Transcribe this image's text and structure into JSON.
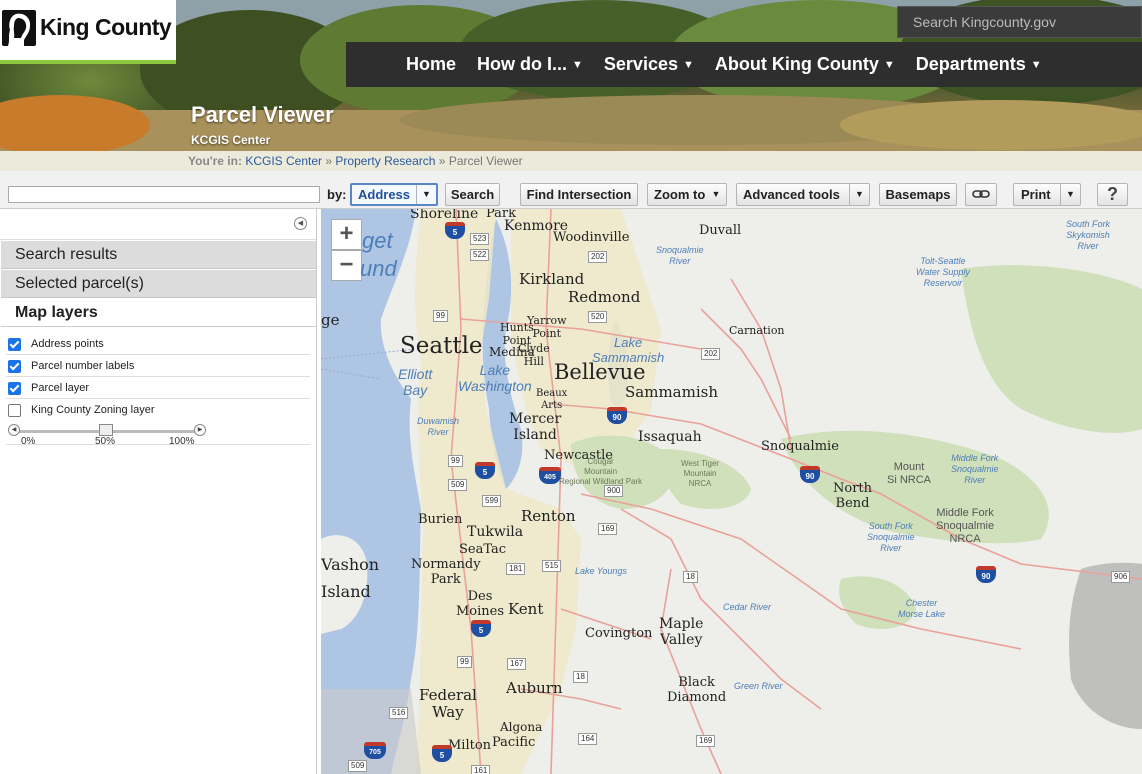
{
  "header": {
    "logo_text": "King County",
    "site_search_placeholder": "Search Kingcounty.gov",
    "nav": [
      {
        "label": "Home",
        "has_menu": false
      },
      {
        "label": "How do I...",
        "has_menu": true
      },
      {
        "label": "Services",
        "has_menu": true
      },
      {
        "label": "About King County",
        "has_menu": true
      },
      {
        "label": "Departments",
        "has_menu": true
      }
    ],
    "caret": "▼",
    "title": "Parcel Viewer",
    "subtitle": "KCGIS Center"
  },
  "breadcrumb": {
    "prefix": "You're in:",
    "items": [
      "KCGIS Center",
      "Property Research"
    ],
    "separator": "»",
    "current": "Parcel Viewer"
  },
  "toolbar": {
    "search_value": "",
    "by_label": "by:",
    "address_label": "Address",
    "search_label": "Search",
    "find_intersection_label": "Find Intersection",
    "zoom_to_label": "Zoom to",
    "advanced_tools_label": "Advanced tools",
    "basemaps_label": "Basemaps",
    "print_label": "Print",
    "help_label": "?"
  },
  "left_panel": {
    "sections": [
      "Search results",
      "Selected parcel(s)",
      "Map layers"
    ],
    "layers": [
      {
        "label": "Address points",
        "checked": true
      },
      {
        "label": "Parcel number labels",
        "checked": true
      },
      {
        "label": "Parcel layer",
        "checked": true
      }
    ],
    "zoning": {
      "label": "King County Zoning layer",
      "checked": false,
      "opacity": 0.5
    },
    "opacity_ticks": [
      "0%",
      "50%",
      "100%"
    ]
  },
  "map": {
    "zoom_in": "+",
    "zoom_out": "−",
    "places": [
      {
        "name": "Shoreline",
        "big": false
      },
      {
        "name": "Park",
        "big": false
      },
      {
        "name": "Kenmore",
        "big": false
      },
      {
        "name": "Woodinville",
        "big": false
      },
      {
        "name": "Duvall",
        "big": false
      },
      {
        "name": "Kirkland",
        "big": false
      },
      {
        "name": "Redmond",
        "big": false
      },
      {
        "name": "Hunts Point",
        "big": false
      },
      {
        "name": "Yarrow Point",
        "big": false
      },
      {
        "name": "Medina",
        "big": false
      },
      {
        "name": "Clyde Hill",
        "big": false
      },
      {
        "name": "Carnation",
        "big": false
      },
      {
        "name": "Seattle",
        "big": true
      },
      {
        "name": "Bellevue",
        "big": true
      },
      {
        "name": "Sammamish",
        "big": false
      },
      {
        "name": "Beaux Arts",
        "big": false
      },
      {
        "name": "Mercer Island",
        "big": false
      },
      {
        "name": "Issaquah",
        "big": false
      },
      {
        "name": "Snoqualmie",
        "big": false
      },
      {
        "name": "Newcastle",
        "big": false
      },
      {
        "name": "North Bend",
        "big": false
      },
      {
        "name": "Burien",
        "big": false
      },
      {
        "name": "Tukwila",
        "big": false
      },
      {
        "name": "SeaTac",
        "big": false
      },
      {
        "name": "Renton",
        "big": false
      },
      {
        "name": "Vashon Island",
        "big": false
      },
      {
        "name": "Normandy Park",
        "big": false
      },
      {
        "name": "Des Moines",
        "big": false
      },
      {
        "name": "Kent",
        "big": false
      },
      {
        "name": "Covington",
        "big": false
      },
      {
        "name": "Maple Valley",
        "big": false
      },
      {
        "name": "Black Diamond",
        "big": false
      },
      {
        "name": "Federal Way",
        "big": false
      },
      {
        "name": "Auburn",
        "big": false
      },
      {
        "name": "Algona",
        "big": false
      },
      {
        "name": "Milton",
        "big": false
      },
      {
        "name": "Pacific",
        "big": false
      },
      {
        "name": "ge",
        "big": false
      }
    ],
    "water_labels": [
      "get",
      "und",
      "Snoqualmie River",
      "South Fork Skykomish River",
      "Tolt-Seattle Water Supply Reservoir",
      "Lake Sammamish",
      "Elliott Bay",
      "Lake Washington",
      "Duwamish River",
      "Lake Youngs",
      "Cedar River",
      "Chester Morse Lake",
      "Green River",
      "Middle Fork Snoqualmie River",
      "South Fork Snoqualmie River"
    ],
    "park_labels": [
      "Cougar Mountain Regional Wildland Park",
      "West Tiger Mountain NRCA",
      "Mount Si NRCA",
      "Middle Fork Snoqualmie NRCA"
    ],
    "interstates": [
      "5",
      "5",
      "5",
      "5",
      "90",
      "90",
      "90",
      "405",
      "705"
    ],
    "routes": [
      "523",
      "522",
      "202",
      "99",
      "520",
      "202",
      "99",
      "509",
      "599",
      "169",
      "181",
      "515",
      "18",
      "516",
      "167",
      "99",
      "18",
      "900",
      "164",
      "169",
      "161",
      "906",
      "509"
    ]
  }
}
